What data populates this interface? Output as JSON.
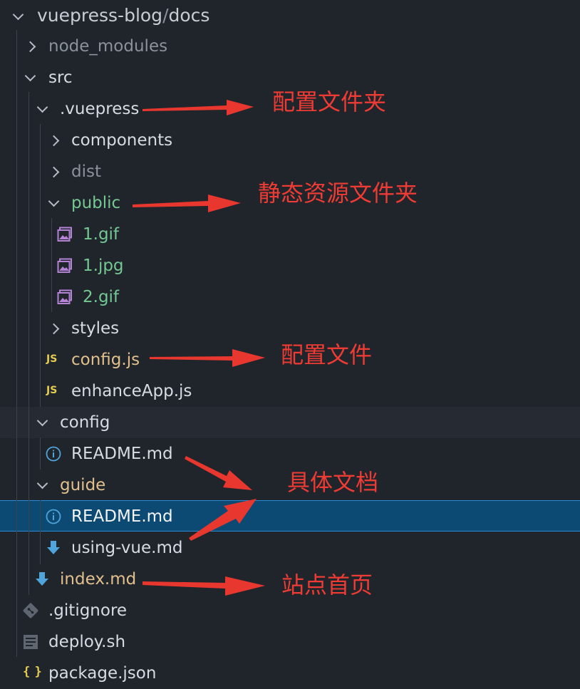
{
  "explorer": {
    "root": {
      "name": "vuepress-blog",
      "separator": "/",
      "subfolder": "docs"
    },
    "items": {
      "node_modules": "node_modules",
      "src": "src",
      "vuepress": ".vuepress",
      "components": "components",
      "dist": "dist",
      "public": "public",
      "gif1": "1.gif",
      "jpg1": "1.jpg",
      "gif2": "2.gif",
      "styles": "styles",
      "config_js": "config.js",
      "enhance_app": "enhanceApp.js",
      "config_folder": "config",
      "config_readme": "README.md",
      "guide_folder": "guide",
      "guide_readme": "README.md",
      "using_vue": "using-vue.md",
      "index_md": "index.md",
      "gitignore": ".gitignore",
      "deploy": "deploy.sh",
      "package": "package.json"
    },
    "icons": {
      "js_badge": "JS",
      "json_badge": "{ }"
    }
  },
  "annotations": {
    "config_folder": "配置文件夹",
    "static_resources": "静态资源文件夹",
    "config_file": "配置文件",
    "docs": "具体文档",
    "homepage": "站点首页"
  },
  "colors": {
    "background": "#20242b",
    "selected": "#0c4a73",
    "annotation": "#ee3c34",
    "green": "#73c991",
    "yellow": "#e2c08d",
    "image_icon": "#b583d6",
    "info_icon": "#4fa5db",
    "markdown_icon": "#4fa5db"
  }
}
